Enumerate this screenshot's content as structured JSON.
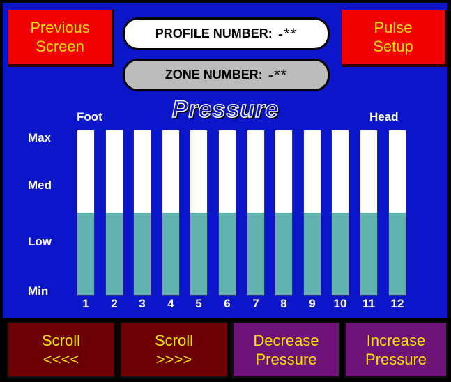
{
  "header": {
    "previous_screen": [
      "Previous",
      "Screen"
    ],
    "pulse_setup": [
      "Pulse",
      "Setup"
    ],
    "profile_label": "PROFILE NUMBER:",
    "profile_value": "-**",
    "zone_label": "ZONE NUMBER:",
    "zone_value": "-**"
  },
  "chart": {
    "title": "Pressure",
    "left_end_label": "Foot",
    "right_end_label": "Head",
    "levels": [
      "Max",
      "Med",
      "Low",
      "Min"
    ],
    "zones": [
      "1",
      "2",
      "3",
      "4",
      "5",
      "6",
      "7",
      "8",
      "9",
      "10",
      "11",
      "12"
    ],
    "pressure_fraction": [
      0.5,
      0.5,
      0.5,
      0.5,
      0.5,
      0.5,
      0.5,
      0.5,
      0.5,
      0.5,
      0.5,
      0.5
    ],
    "fill_color": "#62b2ae",
    "empty_color": "#ffffff"
  },
  "footer": {
    "scroll_left": [
      "Scroll",
      "<<<<"
    ],
    "scroll_right": [
      "Scroll",
      ">>>>"
    ],
    "decrease": [
      "Decrease",
      "Pressure"
    ],
    "increase": [
      "Increase",
      "Pressure"
    ]
  },
  "colors": {
    "panel_blue": "#0a16c8",
    "button_red": "#f00000",
    "button_maroon": "#6a0000",
    "button_purple": "#6f1277",
    "button_text_yellow": "#f2e300"
  }
}
